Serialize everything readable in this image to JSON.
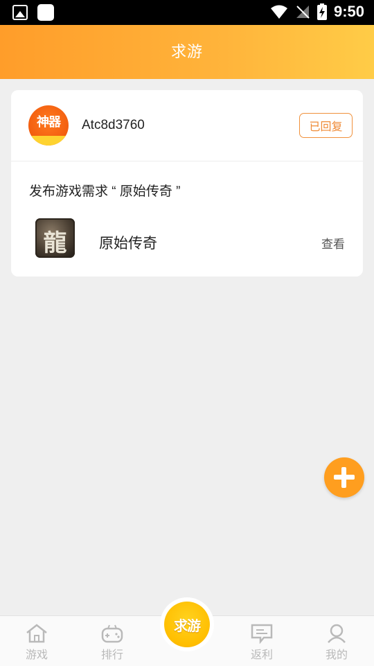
{
  "status_bar": {
    "time": "9:50"
  },
  "header": {
    "title": "求游"
  },
  "post": {
    "avatar_text": "神器",
    "username": "Atc8d3760",
    "status_button": "已回复",
    "request_text": "发布游戏需求 “ 原始传奇 ”",
    "game": {
      "icon_glyph": "龍",
      "name": "原始传奇",
      "view_label": "查看"
    }
  },
  "bottom_nav": {
    "items": [
      {
        "label": "游戏",
        "icon": "home-icon"
      },
      {
        "label": "排行",
        "icon": "gamepad-icon"
      },
      {
        "label": "求游",
        "icon": "request-game-icon"
      },
      {
        "label": "返利",
        "icon": "message-icon"
      },
      {
        "label": "我的",
        "icon": "user-icon"
      }
    ]
  },
  "colors": {
    "accent": "#ff9e1f",
    "header_start": "#ff9d2a",
    "header_end": "#ffcc47",
    "inactive": "#b9b9b9"
  }
}
